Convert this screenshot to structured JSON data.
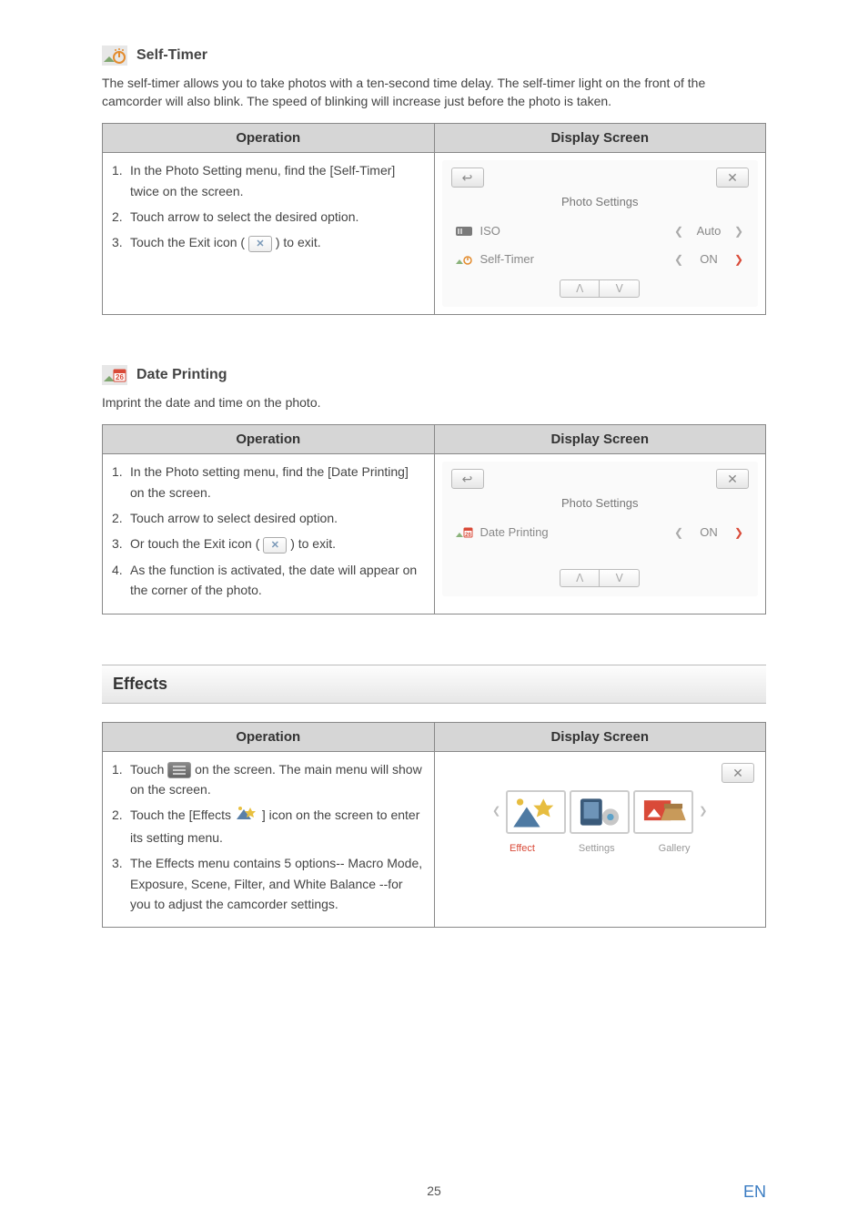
{
  "sections": {
    "selfTimer": {
      "heading": "Self-Timer",
      "intro": "The self-timer allows you to take photos with a ten-second time delay. The self-timer light on the front of the camcorder will also blink. The speed of blinking will increase just before the photo is taken.",
      "colOperation": "Operation",
      "colDisplay": "Display Screen",
      "steps": [
        {
          "n": "1.",
          "t": "In the Photo Setting menu, find the [Self-Timer] twice on the screen."
        },
        {
          "n": "2.",
          "t": "Touch arrow to select the desired option."
        },
        {
          "n": "3.",
          "pre": "Touch the Exit icon ( ",
          "post": " ) to exit."
        }
      ],
      "ds": {
        "title": "Photo Settings",
        "rows": [
          {
            "label": "ISO",
            "value": "Auto",
            "highlighted": false
          },
          {
            "label": "Self-Timer",
            "value": "ON",
            "highlighted": true
          }
        ]
      }
    },
    "datePrinting": {
      "heading": "Date Printing",
      "intro": "Imprint the date and time on the photo.",
      "colOperation": "Operation",
      "colDisplay": "Display Screen",
      "steps": [
        {
          "n": "1.",
          "t": "In the Photo setting menu, find the [Date Printing] on the screen."
        },
        {
          "n": "2.",
          "t": "Touch arrow to select desired option."
        },
        {
          "n": "3.",
          "pre": "Or touch the Exit icon ( ",
          "post": " ) to exit."
        },
        {
          "n": "4.",
          "t": "As the function is activated, the date will appear on the corner of the photo."
        }
      ],
      "ds": {
        "title": "Photo Settings",
        "rows": [
          {
            "label": "Date Printing",
            "value": "ON",
            "highlighted": true
          }
        ],
        "calNum": "26"
      }
    },
    "effects": {
      "heading": "Effects",
      "colOperation": "Operation",
      "colDisplay": "Display Screen",
      "steps": [
        {
          "n": "1.",
          "pre": "Touch ",
          "post": " on the screen. The main menu will show on the screen."
        },
        {
          "n": "2.",
          "pre": "Touch the [Effects ",
          "post": " ] icon on the screen to enter its setting menu."
        },
        {
          "n": "3.",
          "t": "The Effects menu contains 5 options-- Macro Mode, Exposure, Scene, Filter, and White Balance --for you to adjust the camcorder settings."
        }
      ],
      "ds": {
        "labels": [
          "Effect",
          "Settings",
          "Gallery"
        ]
      }
    }
  },
  "pageNum": "25",
  "lang": "EN",
  "icons": {
    "calNum": "26"
  }
}
